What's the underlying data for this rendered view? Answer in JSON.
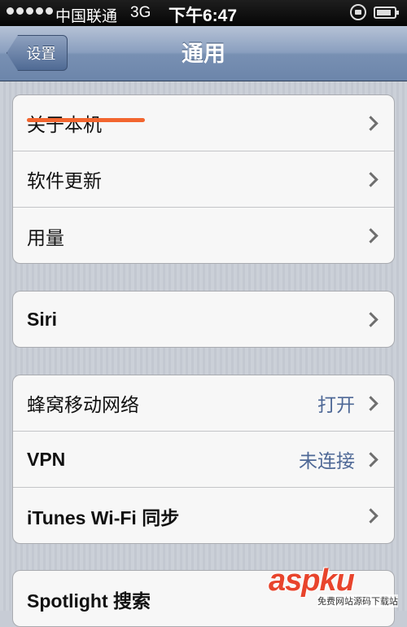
{
  "status_bar": {
    "carrier": "中国联通",
    "network": "3G",
    "time": "下午6:47"
  },
  "nav": {
    "back_label": "设置",
    "title": "通用"
  },
  "sections": [
    {
      "rows": [
        {
          "label": "关于本机"
        },
        {
          "label": "软件更新"
        },
        {
          "label": "用量"
        }
      ]
    },
    {
      "rows": [
        {
          "label": "Siri"
        }
      ]
    },
    {
      "rows": [
        {
          "label": "蜂窝移动网络",
          "value": "打开"
        },
        {
          "label": "VPN",
          "value": "未连接"
        },
        {
          "label": "iTunes Wi-Fi 同步"
        }
      ]
    },
    {
      "rows": [
        {
          "label": "Spotlight 搜索"
        }
      ]
    }
  ],
  "watermark": {
    "text": "aspku",
    "sub": "免费网站源码下载站"
  },
  "colors": {
    "accent_value": "#4e6896",
    "annotation": "#f2652f"
  }
}
